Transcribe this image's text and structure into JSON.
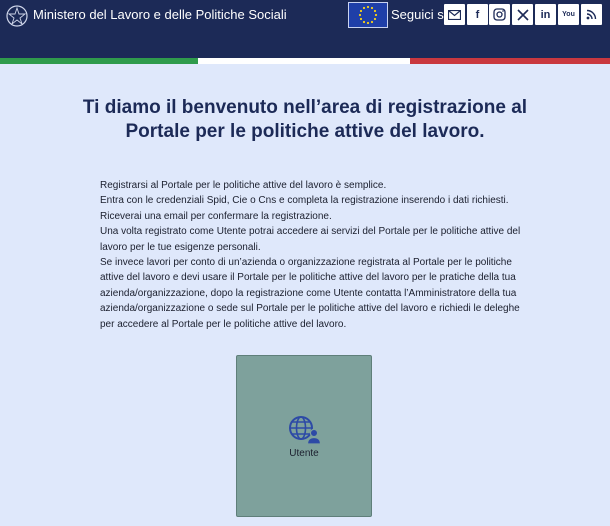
{
  "header": {
    "ministry_name": "Ministero del Lavoro e delle Politiche Sociali",
    "follow_label": "Seguici su:",
    "social": [
      {
        "icon": "mail-icon",
        "text": ""
      },
      {
        "icon": "facebook-icon",
        "text": "f"
      },
      {
        "icon": "instagram-icon",
        "text": ""
      },
      {
        "icon": "x-icon",
        "text": ""
      },
      {
        "icon": "linkedin-icon",
        "text": "in"
      },
      {
        "icon": "youtube-icon",
        "text": "You"
      },
      {
        "icon": "rss-icon",
        "text": ""
      }
    ]
  },
  "colors": {
    "header_bg": "#1c2a57",
    "page_bg": "#dfe8fb",
    "flag_green": "#2f9b4c",
    "flag_white": "#ffffff",
    "flag_red": "#c9383f",
    "card_bg": "#7ea19c",
    "icon_accent": "#2d4aa6"
  },
  "main": {
    "title": "Ti diamo il benvenuto nell’area di registrazione al Portale per le politiche attive del lavoro.",
    "paragraphs": [
      "Registrarsi al Portale per le politiche attive del lavoro è semplice.",
      "Entra con le credenziali Spid, Cie o Cns e completa la registrazione inserendo i dati richiesti.",
      "Riceverai una email per confermare la registrazione.",
      "Una volta registrato come Utente potrai accedere ai servizi del Portale per le politiche attive del lavoro per le tue esigenze personali.",
      "Se invece lavori per conto di un’azienda o organizzazione registrata al Portale per le politiche attive del lavoro e devi usare il Portale per le politiche attive del lavoro per le pratiche della tua azienda/organizzazione, dopo la registrazione come Utente contatta l’Amministratore della tua azienda/organizzazione o sede sul Portale per le politiche attive del lavoro e richiedi le deleghe per accedere al Portale per le politiche attive del lavoro."
    ],
    "card": {
      "icon": "globe-user-icon",
      "label": "Utente"
    }
  }
}
